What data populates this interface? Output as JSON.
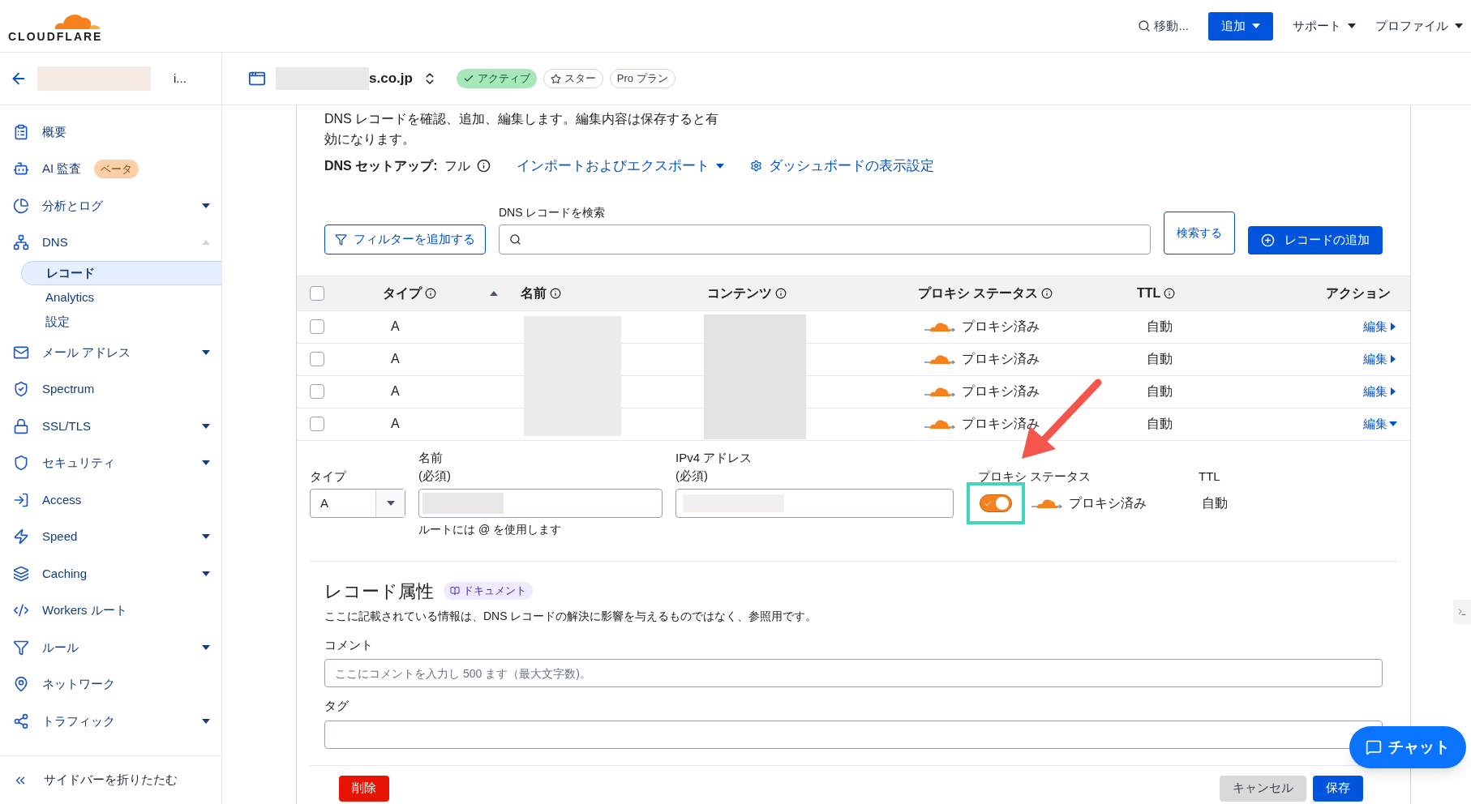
{
  "topbar": {
    "logo": "CLOUDFLARE",
    "search": "移動...",
    "add_button": "追加",
    "menus": [
      "サポート",
      "プロファイル"
    ]
  },
  "account": {
    "name_tail": "i..."
  },
  "zone": {
    "domain": "s.co.jp",
    "badges": [
      {
        "kind": "status",
        "label": "アクティブ"
      },
      {
        "kind": "star",
        "label": "スター"
      },
      {
        "kind": "plan",
        "label": "Pro プラン"
      }
    ]
  },
  "sidebar": {
    "items": [
      {
        "label": "概要"
      },
      {
        "label": "AI 監査",
        "badge": "ベータ"
      },
      {
        "label": "分析とログ",
        "expanded": false
      },
      {
        "label": "DNS",
        "expanded": true,
        "children": [
          {
            "label": "レコード",
            "selected": true
          },
          {
            "label": "Analytics",
            "selected": false
          },
          {
            "label": "設定",
            "selected": false
          }
        ]
      },
      {
        "label": "メール アドレス",
        "expanded": false
      },
      {
        "label": "Spectrum"
      },
      {
        "label": "SSL/TLS",
        "expanded": false
      },
      {
        "label": "セキュリティ",
        "expanded": false
      },
      {
        "label": "Access"
      },
      {
        "label": "Speed",
        "expanded": false
      },
      {
        "label": "Caching",
        "expanded": false
      },
      {
        "label": "Workers ルート"
      },
      {
        "label": "ルール",
        "expanded": false
      },
      {
        "label": "ネットワーク"
      },
      {
        "label": "トラフィック",
        "expanded": false
      }
    ],
    "collapse": "サイドバーを折りたたむ"
  },
  "content": {
    "description": "DNS レコードを確認、追加、編集します。編集内容は保存すると有効になります。",
    "setup_label": "DNS セットアップ:",
    "setup_value": "フル",
    "import_export": "インポートおよびエクスポート",
    "dashboard_settings": "ダッシュボードの表示設定",
    "filter_button": "フィルターを追加する",
    "search_label": "DNS レコードを検索",
    "search_button": "検索する",
    "add_record": "レコードの追加"
  },
  "table": {
    "select_all_checked": false,
    "columns": [
      {
        "label": "タイプ",
        "info": true
      },
      {
        "label": "名前",
        "info": true
      },
      {
        "label": "コンテンツ",
        "info": true
      },
      {
        "label": "プロキシ ステータス",
        "info": true
      },
      {
        "label": "TTL",
        "info": true
      },
      {
        "label": "アクション",
        "info": false
      }
    ],
    "rows": [
      {
        "checked": false,
        "type": "A",
        "proxy": "プロキシ済み",
        "ttl": "自動",
        "action": "編集",
        "expanded": false
      },
      {
        "checked": false,
        "type": "A",
        "proxy": "プロキシ済み",
        "ttl": "自動",
        "action": "編集",
        "expanded": false
      },
      {
        "checked": false,
        "type": "A",
        "proxy": "プロキシ済み",
        "ttl": "自動",
        "action": "編集",
        "expanded": false
      },
      {
        "checked": false,
        "type": "A",
        "proxy": "プロキシ済み",
        "ttl": "自動",
        "action": "編集",
        "expanded": true
      }
    ]
  },
  "edit_form": {
    "type_label": "タイプ",
    "type_value": "A",
    "name_label": "名前",
    "name_required": "(必須)",
    "name_hint": "ルートには @ を使用します",
    "ip_label": "IPv4 アドレス",
    "ip_required": "(必須)",
    "proxy_label": "プロキシ ステータス",
    "proxy_on": true,
    "proxy_text": "プロキシ済み",
    "ttl_label": "TTL",
    "ttl_value": "自動"
  },
  "attributes": {
    "title": "レコード属性",
    "doc_badge": "ドキュメント",
    "description": "ここに記載されている情報は、DNS レコードの解決に影響を与えるものではなく、参照用です。",
    "comment_label": "コメント",
    "comment_placeholder": "ここにコメントを入力し 500 ます（最大文字数)。",
    "tag_label": "タグ"
  },
  "footer": {
    "delete": "削除",
    "cancel": "キャンセル",
    "save": "保存"
  },
  "chat": "チャット"
}
